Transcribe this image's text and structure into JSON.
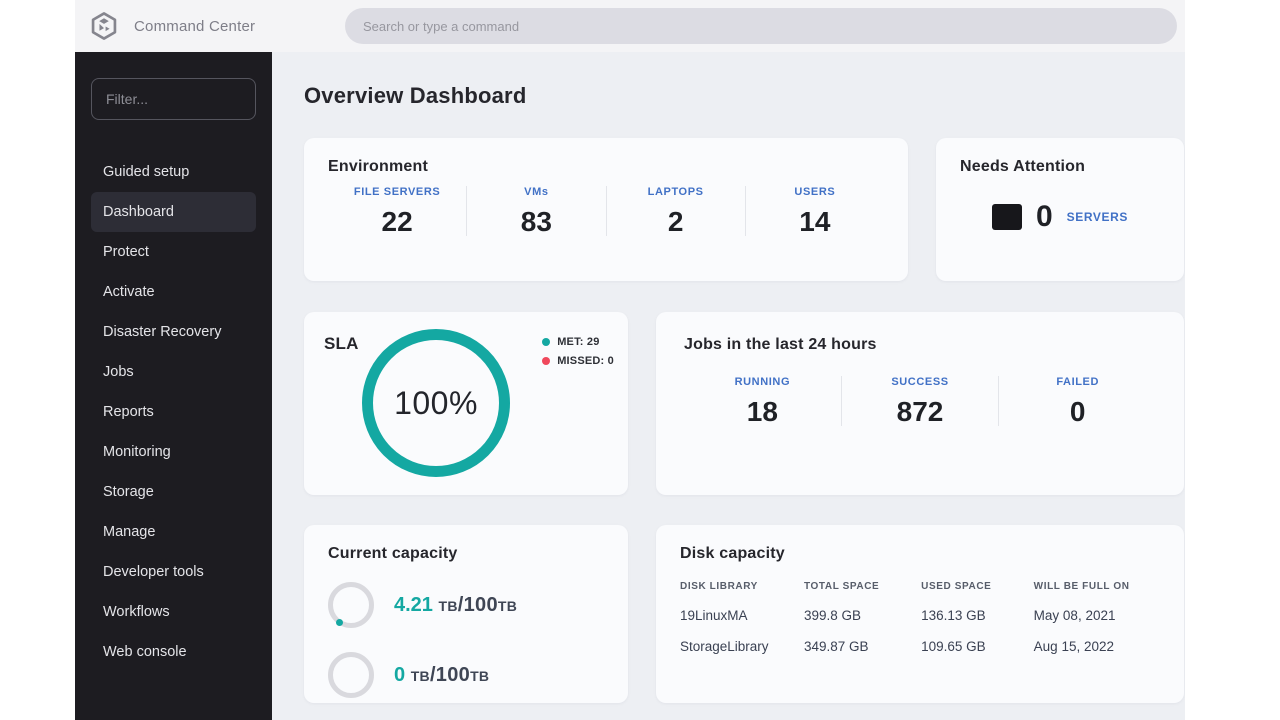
{
  "topbar": {
    "app_title": "Command Center",
    "search_placeholder": "Search or type a command"
  },
  "sidebar": {
    "filter_placeholder": "Filter...",
    "items": [
      {
        "label": "Guided setup"
      },
      {
        "label": "Dashboard"
      },
      {
        "label": "Protect"
      },
      {
        "label": "Activate"
      },
      {
        "label": "Disaster Recovery"
      },
      {
        "label": "Jobs"
      },
      {
        "label": "Reports"
      },
      {
        "label": "Monitoring"
      },
      {
        "label": "Storage"
      },
      {
        "label": "Manage"
      },
      {
        "label": "Developer tools"
      },
      {
        "label": "Workflows"
      },
      {
        "label": "Web console"
      }
    ]
  },
  "main": {
    "page_title": "Overview Dashboard",
    "environment": {
      "title": "Environment",
      "stats": [
        {
          "label": "FILE SERVERS",
          "value": "22"
        },
        {
          "label": "VMs",
          "value": "83"
        },
        {
          "label": "LAPTOPS",
          "value": "2"
        },
        {
          "label": "USERS",
          "value": "14"
        }
      ]
    },
    "needs_attention": {
      "title": "Needs Attention",
      "value": "0",
      "label": "SERVERS"
    },
    "sla": {
      "title": "SLA",
      "percent": "100%",
      "met": 29,
      "missed": 0,
      "legend": [
        {
          "label": "MET: 29",
          "color": "#14a8a2"
        },
        {
          "label": "MISSED: 0",
          "color": "#f0485c"
        }
      ]
    },
    "jobs": {
      "title": "Jobs in the last 24 hours",
      "stats": [
        {
          "label": "RUNNING",
          "value": "18"
        },
        {
          "label": "SUCCESS",
          "value": "872"
        },
        {
          "label": "FAILED",
          "value": "0"
        }
      ]
    },
    "current_capacity": {
      "title": "Current capacity",
      "rows": [
        {
          "value": "4.21",
          "unit": "TB/100TB"
        },
        {
          "value": "0",
          "unit": "TB/100TB"
        }
      ]
    },
    "disk_capacity": {
      "title": "Disk capacity",
      "columns": [
        "DISK LIBRARY",
        "TOTAL SPACE",
        "USED SPACE",
        "WILL BE FULL ON"
      ],
      "rows": [
        [
          "19LinuxMA",
          "399.8 GB",
          "136.13 GB",
          "May 08, 2021"
        ],
        [
          "StorageLibrary",
          "349.87 GB",
          "109.65 GB",
          "Aug 15, 2022"
        ]
      ]
    }
  },
  "colors": {
    "accent_blue": "#4171c6",
    "accent_teal": "#14a8a2",
    "accent_red": "#f0485c",
    "sidebar_bg": "#1d1c21",
    "main_bg": "#edeff3"
  }
}
